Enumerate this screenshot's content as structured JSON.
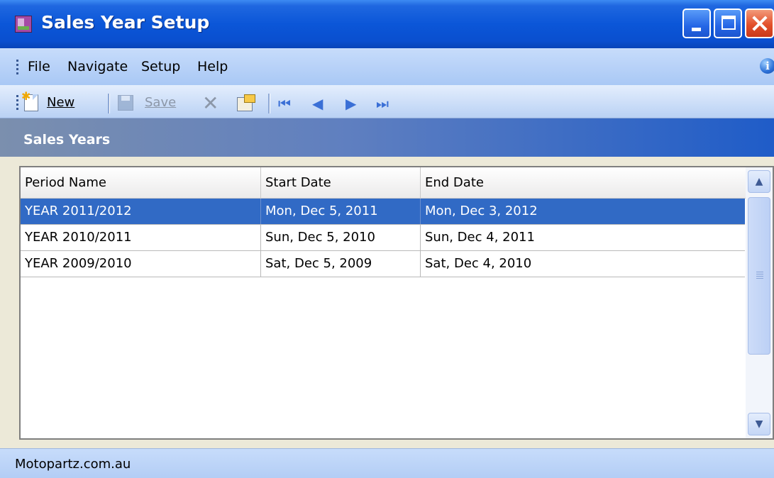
{
  "window": {
    "title": "Sales Year Setup"
  },
  "menu": {
    "items": [
      "File",
      "Navigate",
      "Setup",
      "Help"
    ],
    "info_icon": "info-icon"
  },
  "toolbar": {
    "new_label": "New",
    "save_label": "Save",
    "icons": [
      "new-document-icon",
      "save-icon",
      "delete-icon",
      "properties-icon",
      "first-record-icon",
      "previous-record-icon",
      "next-record-icon",
      "last-record-icon"
    ]
  },
  "section": {
    "title": "Sales Years"
  },
  "grid": {
    "columns": [
      "Period Name",
      "Start Date",
      "End Date"
    ],
    "rows": [
      {
        "period": "YEAR 2011/2012",
        "start": "Mon, Dec 5, 2011",
        "end": "Mon, Dec 3, 2012",
        "selected": true
      },
      {
        "period": "YEAR 2010/2011",
        "start": "Sun, Dec 5, 2010",
        "end": "Sun, Dec 4, 2011",
        "selected": false
      },
      {
        "period": "YEAR 2009/2010",
        "start": "Sat, Dec 5, 2009",
        "end": "Sat, Dec 4, 2010",
        "selected": false
      }
    ]
  },
  "status": {
    "text": "Motopartz.com.au"
  },
  "colors": {
    "selection": "#316ac5",
    "titlebar": "#0b56d8",
    "menubar": "#c7dcfb",
    "section_header": "#1f5cc8"
  }
}
